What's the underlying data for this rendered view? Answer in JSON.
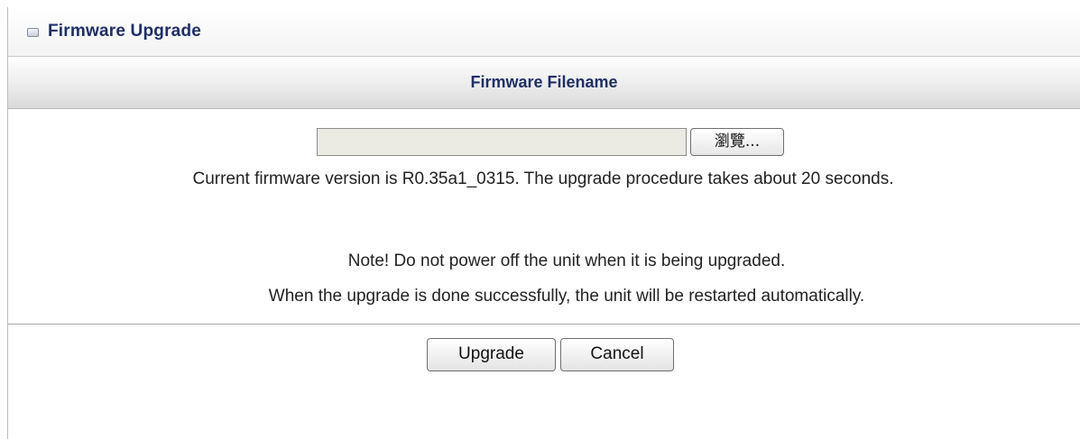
{
  "title_bar": {
    "icon": "window-icon",
    "title": "Firmware Upgrade"
  },
  "section": {
    "header": "Firmware Filename"
  },
  "file_upload": {
    "value": "",
    "browse_label": "瀏覽..."
  },
  "messages": {
    "version_prefix": "Current firmware version is ",
    "version": "R0.35a1_0315",
    "version_suffix": ". The upgrade procedure takes about 20 seconds.",
    "note": "Note! Do not power off the unit when it is being upgraded.",
    "restart": "When the upgrade is done successfully, the unit will be restarted automatically."
  },
  "actions": {
    "upgrade_label": "Upgrade",
    "cancel_label": "Cancel"
  }
}
